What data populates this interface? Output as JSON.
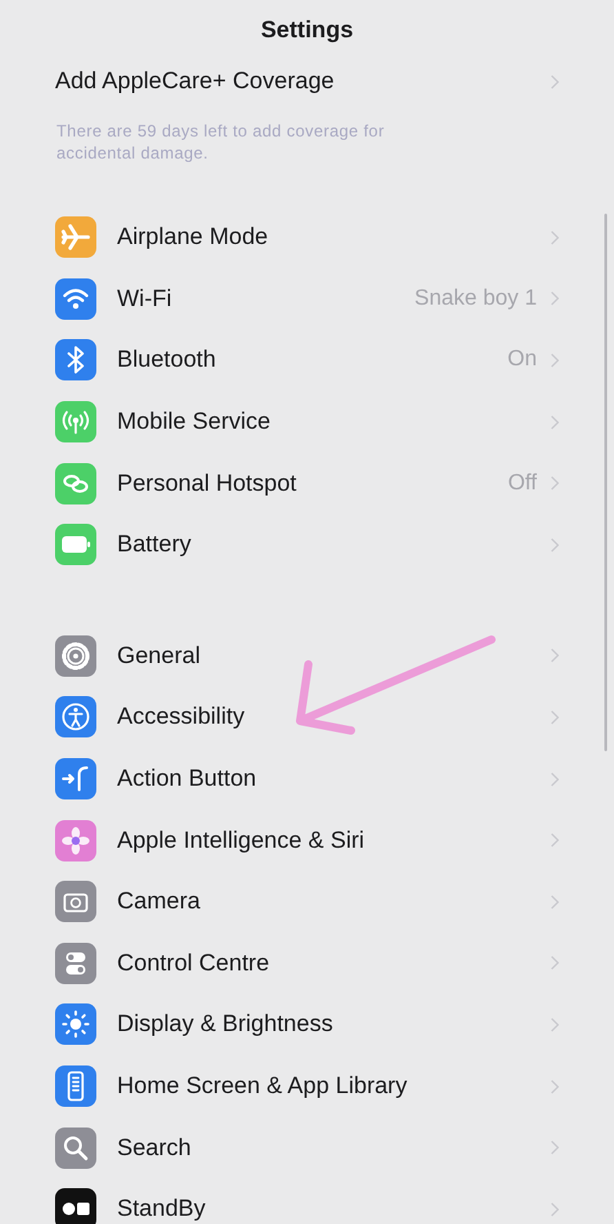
{
  "title": "Settings",
  "applecare": {
    "label": "Add AppleCare+ Coverage",
    "note": "There are 59 days left to add coverage for accidental damage."
  },
  "groups": [
    {
      "rows": [
        {
          "label": "Airplane Mode",
          "color": "#f2a93b"
        },
        {
          "label": "Wi-Fi",
          "value": "Snake boy 1",
          "color": "#2f80ed"
        },
        {
          "label": "Bluetooth",
          "value": "On",
          "color": "#2f80ed"
        },
        {
          "label": "Mobile Service",
          "color": "#4cd068"
        },
        {
          "label": "Personal Hotspot",
          "value": "Off",
          "color": "#4cd068"
        },
        {
          "label": "Battery",
          "color": "#4cd068"
        }
      ]
    },
    {
      "rows": [
        {
          "label": "General",
          "color": "#8e8e96"
        },
        {
          "label": "Accessibility",
          "color": "#2f80ed"
        },
        {
          "label": "Action Button",
          "color": "#2f80ed"
        },
        {
          "label": "Apple Intelligence & Siri",
          "color": "#e27fd3"
        },
        {
          "label": "Camera",
          "color": "#8e8e96"
        },
        {
          "label": "Control Centre",
          "color": "#8e8e96"
        },
        {
          "label": "Display & Brightness",
          "color": "#2f80ed"
        },
        {
          "label": "Home Screen & App Library",
          "color": "#2f80ed"
        },
        {
          "label": "Search",
          "color": "#8e8e96"
        },
        {
          "label": "StandBy",
          "color": "#111111"
        }
      ]
    }
  ]
}
